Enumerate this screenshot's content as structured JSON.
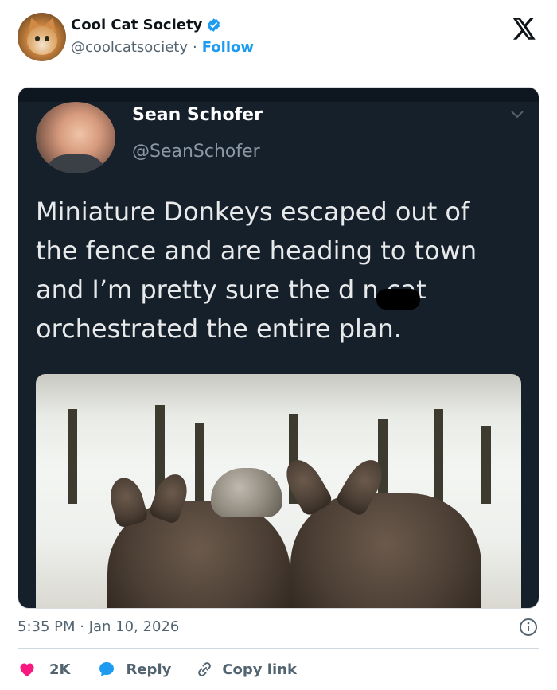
{
  "account": {
    "name": "Cool Cat Society",
    "handle": "@coolcatsociety",
    "separator": "·",
    "follow_label": "Follow"
  },
  "embedded_tweet": {
    "name": "Sean Schofer",
    "handle": "@SeanSchofer",
    "text": "Miniature Donkeys escaped out of\nthe fence and are heading to town\nand I’m pretty sure the d      n cat\norchestrated the entire plan."
  },
  "meta": {
    "timestamp": "5:35 PM · Jan 10, 2026"
  },
  "actions": {
    "like_count": "2K",
    "reply_label": "Reply",
    "copy_link_label": "Copy link"
  },
  "colors": {
    "accent": "#1d9bf0",
    "like": "#f91880",
    "muted": "#536471",
    "dark_bg": "#15202b"
  }
}
